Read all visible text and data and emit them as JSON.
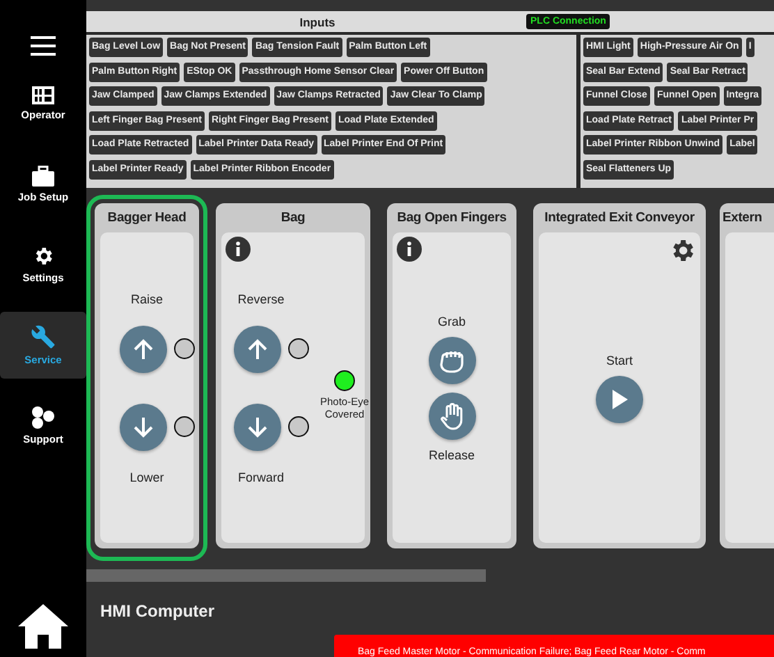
{
  "sidebar": {
    "items": [
      {
        "label": "Operator",
        "kind": "grid",
        "selected": false
      },
      {
        "label": "Job Setup",
        "kind": "briefcase",
        "selected": false
      },
      {
        "label": "Settings",
        "kind": "gear",
        "selected": false
      },
      {
        "label": "Service",
        "kind": "wrench",
        "selected": true
      },
      {
        "label": "Support",
        "kind": "dots",
        "selected": false
      }
    ]
  },
  "io_panel": {
    "inputs_title": "Inputs",
    "plc_connection": "PLC Connection",
    "inputs": [
      [
        "Bag Level Low",
        "Bag Not Present",
        "Bag Tension Fault",
        "Palm Button Left"
      ],
      [
        "Palm Button Right",
        "EStop OK",
        "Passthrough Home Sensor Clear",
        "Power Off Button"
      ],
      [
        "Jaw Clamped",
        "Jaw Clamps Extended",
        "Jaw Clamps Retracted",
        "Jaw Clear To Clamp"
      ],
      [
        "Left Finger Bag Present",
        "Right Finger Bag Present",
        "Load Plate Extended"
      ],
      [
        "Load Plate Retracted",
        "Label Printer Data Ready",
        "Label Printer End Of Print"
      ],
      [
        "Label Printer Ready",
        "Label Printer Ribbon Encoder"
      ]
    ],
    "outputs": [
      [
        "HMI Light",
        "High-Pressure Air On",
        "I"
      ],
      [
        "Seal Bar Extend",
        "Seal Bar Retract"
      ],
      [
        "Funnel Close",
        "Funnel Open",
        "Integra"
      ],
      [
        "Load Plate Retract",
        "Label Printer Pr"
      ],
      [
        "Label Printer Ribbon Unwind",
        "Label"
      ],
      [
        "Seal Flatteners Up"
      ]
    ]
  },
  "cards": [
    {
      "title": "Bagger Head",
      "selected": true,
      "info": false,
      "settings": false,
      "columns": [
        [
          {
            "kind": "label",
            "text": "Raise"
          },
          {
            "kind": "up",
            "lit": false
          },
          {
            "kind": "down",
            "lit": false
          },
          {
            "kind": "label",
            "text": "Lower"
          }
        ]
      ]
    },
    {
      "title": "Bag",
      "selected": false,
      "info": true,
      "settings": false,
      "columns": [
        [
          {
            "kind": "label",
            "text": "Reverse"
          },
          {
            "kind": "up",
            "lit": false
          },
          {
            "kind": "down",
            "lit": false
          },
          {
            "kind": "label",
            "text": "Forward"
          }
        ],
        [
          {
            "kind": "lamp",
            "lit": true,
            "text": "Photo-Eye Covered"
          }
        ]
      ]
    },
    {
      "title": "Bag Open Fingers",
      "selected": false,
      "info": true,
      "settings": false,
      "columns": [
        [
          {
            "kind": "label",
            "text": "Grab"
          },
          {
            "kind": "grab"
          },
          {
            "kind": "release"
          },
          {
            "kind": "label",
            "text": "Release"
          }
        ]
      ]
    },
    {
      "title": "Integrated Exit Conveyor",
      "selected": false,
      "info": false,
      "settings": true,
      "columns": [
        [
          {
            "kind": "label",
            "text": "Start"
          },
          {
            "kind": "start"
          }
        ]
      ]
    },
    {
      "title": "Extern",
      "selected": false
    }
  ],
  "footer": {
    "title": "HMI Computer",
    "alarm": "Bag Feed Master Motor - Communication Failure; Bag Feed Rear Motor - Comm"
  }
}
